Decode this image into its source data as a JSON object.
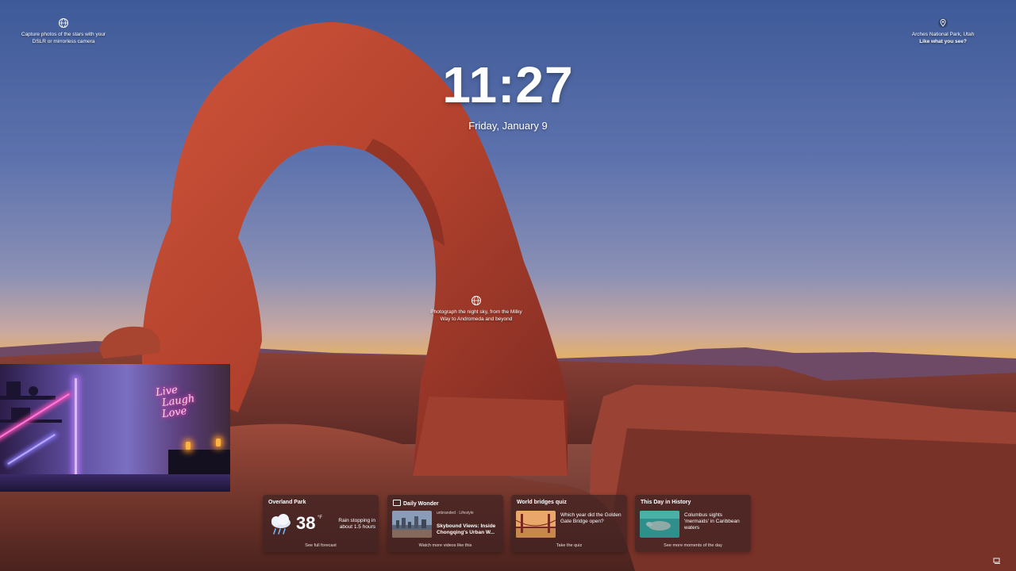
{
  "lock_screen": {
    "time": "11:27",
    "date": "Friday, January 9"
  },
  "tips": {
    "left": {
      "icon": "globe-icon",
      "line1": "Capture photos of the stars with your",
      "line2": "DSLR or mirrorless camera"
    },
    "right": {
      "icon": "location-pin-icon",
      "line1": "Arches National Park, Utah",
      "line2": "Like what you see?"
    },
    "center": {
      "icon": "globe-icon",
      "line1": "Photograph the night sky, from the Milky",
      "line2": "Way to Andromeda and beyond"
    }
  },
  "camera_preview": {
    "neon_sign": [
      "Live",
      "Laugh",
      "Love"
    ]
  },
  "widgets": [
    {
      "title": "Overland Park",
      "temperature": "38",
      "unit": "°F",
      "condition_line1": "Rain stopping in",
      "condition_line2": "about 1.5 hours",
      "footer": "See full forecast",
      "icon": "rain-cloud-icon"
    },
    {
      "title": "Daily Wonder",
      "source": "unbranded · Lifestyle",
      "headline": "Skybound Views: Inside Chongqing's Urban W...",
      "footer": "Watch more videos like this"
    },
    {
      "title": "World bridges quiz",
      "question": "Which year did the Golden Gate Bridge open?",
      "footer": "Take the quiz"
    },
    {
      "title": "This Day in History",
      "headline": "Columbus sights 'mermaids' in Caribbean waters",
      "footer": "See more moments of the day"
    }
  ]
}
